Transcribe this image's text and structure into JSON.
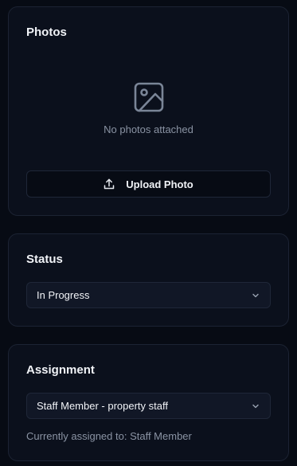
{
  "photos": {
    "title": "Photos",
    "empty_icon": "image-placeholder-icon",
    "empty_text": "No photos attached",
    "upload_icon": "upload-icon",
    "upload_label": "Upload Photo"
  },
  "status": {
    "title": "Status",
    "selected": "In Progress",
    "chevron_icon": "chevron-down-icon"
  },
  "assignment": {
    "title": "Assignment",
    "selected": "Staff Member - property staff",
    "chevron_icon": "chevron-down-icon",
    "current_text": "Currently assigned to: Staff Member"
  },
  "colors": {
    "background": "#070b14",
    "card": "#0b101c",
    "border": "#1c2333",
    "muted_text": "#8a93a3",
    "icon": "#7a8597"
  }
}
